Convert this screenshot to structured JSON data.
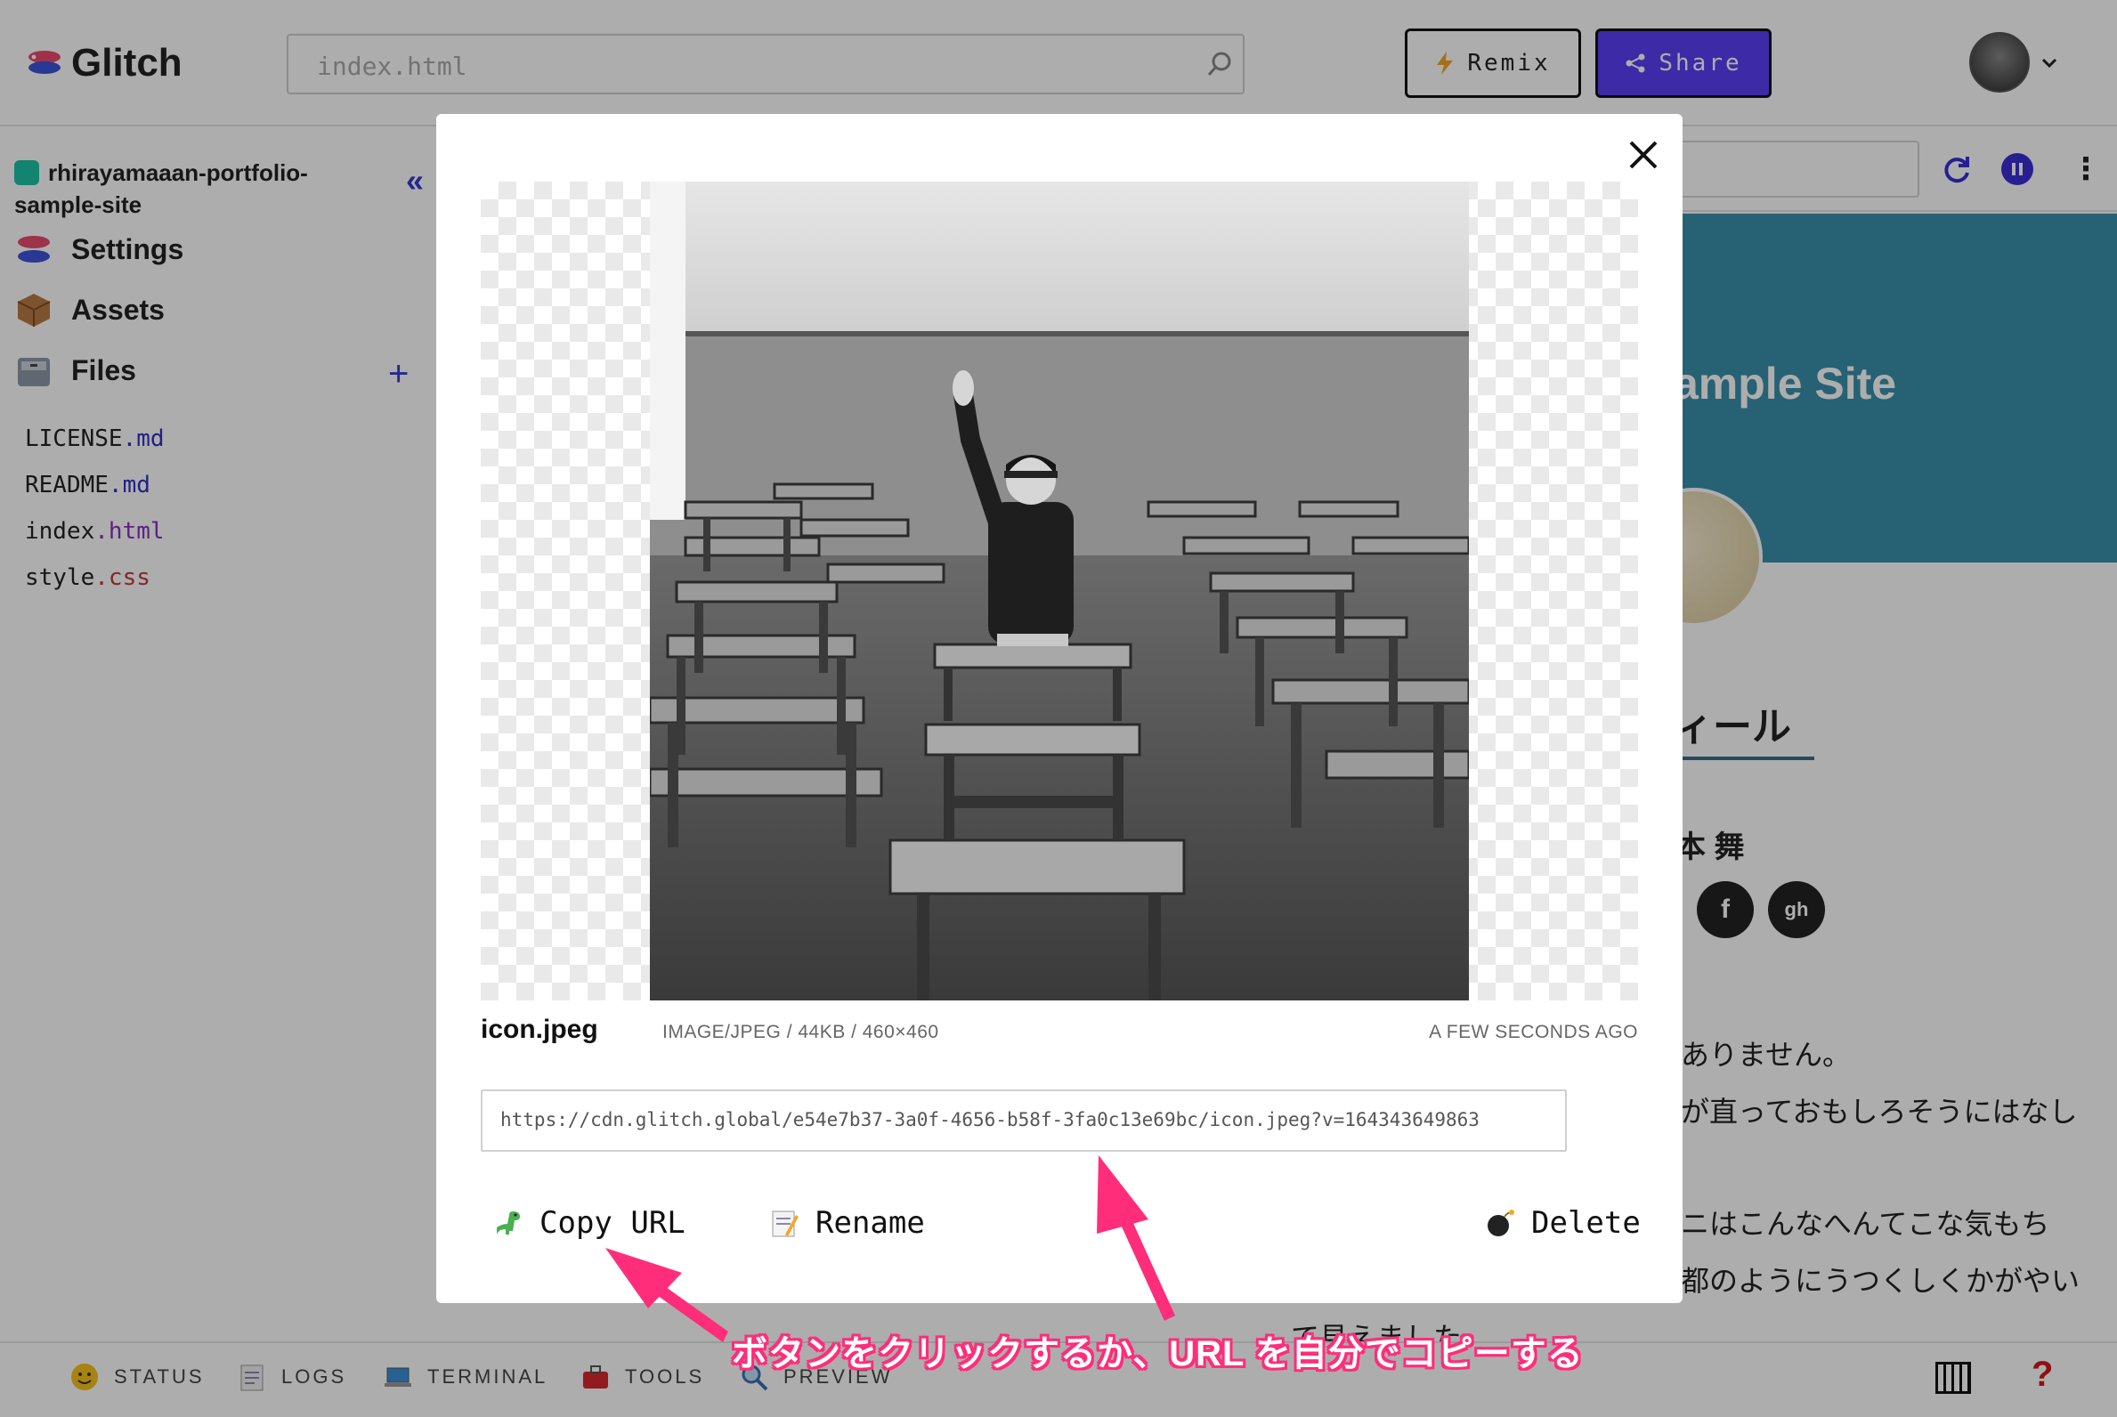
{
  "header": {
    "logo_text": "Glitch",
    "search_placeholder": "index.html",
    "remix_label": "Remix",
    "share_label": "Share"
  },
  "sidebar": {
    "project_name": "rhirayamaaan-portfolio-sample-site",
    "collapse_glyph": "«",
    "items": [
      {
        "label": "Settings",
        "icon": "settings-fish-icon"
      },
      {
        "label": "Assets",
        "icon": "package-icon"
      },
      {
        "label": "Files",
        "icon": "file-cabinet-icon"
      }
    ],
    "add_glyph": "+",
    "files": [
      {
        "base": "LICENSE",
        "ext": ".md"
      },
      {
        "base": "README",
        "ext": ".md"
      },
      {
        "base": "index",
        "ext": ".html"
      },
      {
        "base": "style",
        "ext": ".css"
      }
    ]
  },
  "preview": {
    "site_title": "ample Site",
    "section_heading": "ィール",
    "name": "本 舞",
    "social": [
      "f",
      "gh"
    ],
    "lines": [
      "ありません。",
      "が直っておもしろそうにはなし",
      "ニはこんなへんてこな気もち",
      "都のようにうつくしくかがやい",
      "て見えました"
    ]
  },
  "bottom_bar": {
    "items": [
      {
        "label": "STATUS",
        "icon": "smiley-icon"
      },
      {
        "label": "LOGS",
        "icon": "memo-icon"
      },
      {
        "label": "TERMINAL",
        "icon": "laptop-icon"
      },
      {
        "label": "TOOLS",
        "icon": "toolbox-icon"
      },
      {
        "label": "PREVIEW",
        "icon": "magnifier-icon"
      }
    ],
    "help_glyph": "?"
  },
  "modal": {
    "file_name": "icon.jpeg",
    "meta": "IMAGE/JPEG / 44KB / 460×460",
    "uploaded": "A FEW SECONDS AGO",
    "url": "https://cdn.glitch.global/e54e7b37-3a0f-4656-b58f-3fa0c13e69bc/icon.jpeg?v=164343649863",
    "actions": {
      "copy": "Copy URL",
      "rename": "Rename",
      "delete": "Delete"
    }
  },
  "annotation": {
    "text": "ボタンをクリックするか、URL を自分でコピーする",
    "color": "#ff2d7a"
  },
  "colors": {
    "share_bg": "#5a3ff5",
    "accent_blue": "#3a3ad0",
    "site_banner": "#3a8fab",
    "help_red": "#d01919"
  }
}
